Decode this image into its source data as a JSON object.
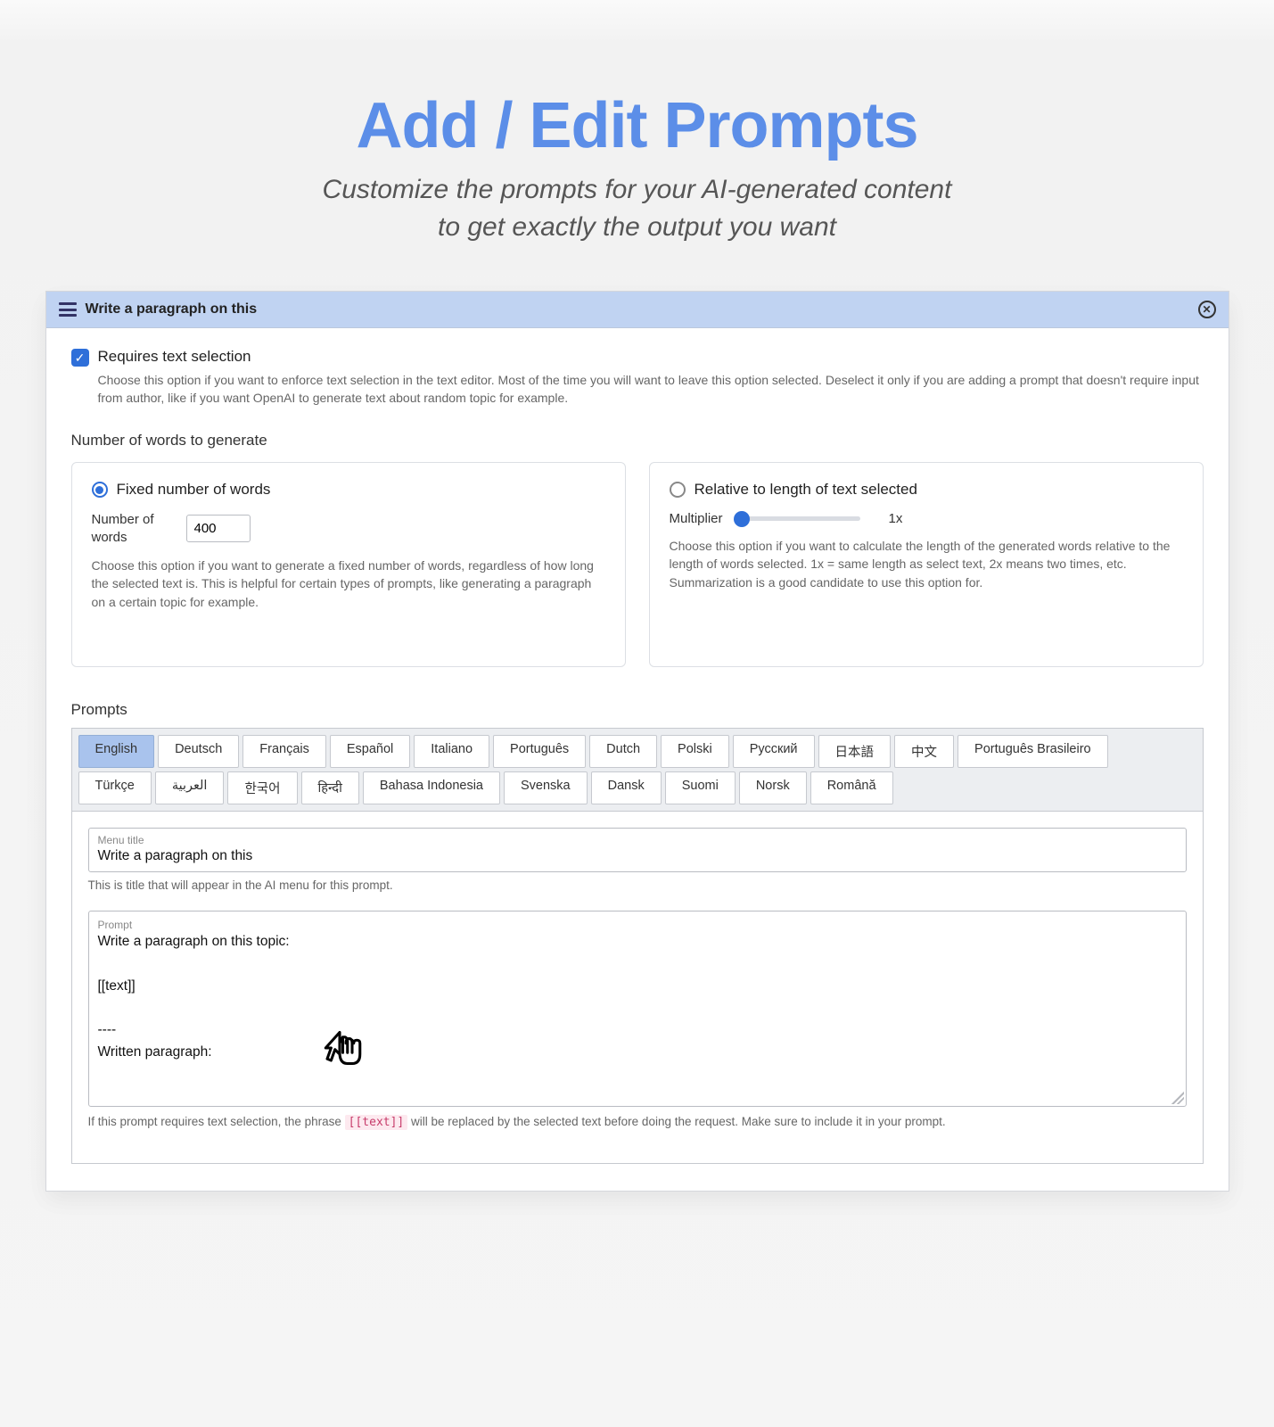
{
  "header": {
    "title": "Add / Edit Prompts",
    "subtitle_line1": "Customize the prompts for your AI-generated content",
    "subtitle_line2": "to get exactly the output you want"
  },
  "panel": {
    "title": "Write a paragraph on this"
  },
  "requires": {
    "label": "Requires text selection",
    "help": "Choose this option if you want to enforce text selection in the text editor. Most of the time you will want to leave this option selected. Deselect it only if you are adding a prompt that doesn't require input from author, like if you want OpenAI to generate text about random topic for example.",
    "checked": true
  },
  "numwords": {
    "section_label": "Number of words to generate",
    "fixed": {
      "radio_label": "Fixed number of words",
      "input_label": "Number of words",
      "value": "400",
      "help": "Choose this option if you want to generate a fixed number of words, regardless of how long the selected text is. This is helpful for certain types of prompts, like generating a paragraph on a certain topic for example."
    },
    "relative": {
      "radio_label": "Relative to length of text selected",
      "slider_label": "Multiplier",
      "slider_value": "1x",
      "help": "Choose this option if you want to calculate the length of the generated words relative to the length of words selected. 1x = same length as select text, 2x means two times, etc. Summarization is a good candidate to use this option for."
    }
  },
  "prompts": {
    "section_label": "Prompts",
    "tabs_row1": [
      "English",
      "Deutsch",
      "Français",
      "Español",
      "Italiano",
      "Português",
      "Dutch",
      "Polski",
      "Русский",
      "日本語",
      "中文",
      "Português Brasileiro"
    ],
    "tabs_row2": [
      "Türkçe",
      "العربية",
      "한국어",
      "हिन्दी",
      "Bahasa Indonesia",
      "Svenska",
      "Dansk",
      "Suomi",
      "Norsk",
      "Română"
    ],
    "active_tab": "English",
    "menu_title_label": "Menu title",
    "menu_title_value": "Write a paragraph on this",
    "menu_title_help": "This is title that will appear in the AI menu for this prompt.",
    "prompt_label": "Prompt",
    "prompt_value": "Write a paragraph on this topic:\n\n[[text]]\n\n----\nWritten paragraph:",
    "prompt_help_pre": "If this prompt requires text selection, the phrase ",
    "prompt_help_code": "[[text]]",
    "prompt_help_post": " will be replaced by the selected text before doing the request. Make sure to include it in your prompt."
  }
}
